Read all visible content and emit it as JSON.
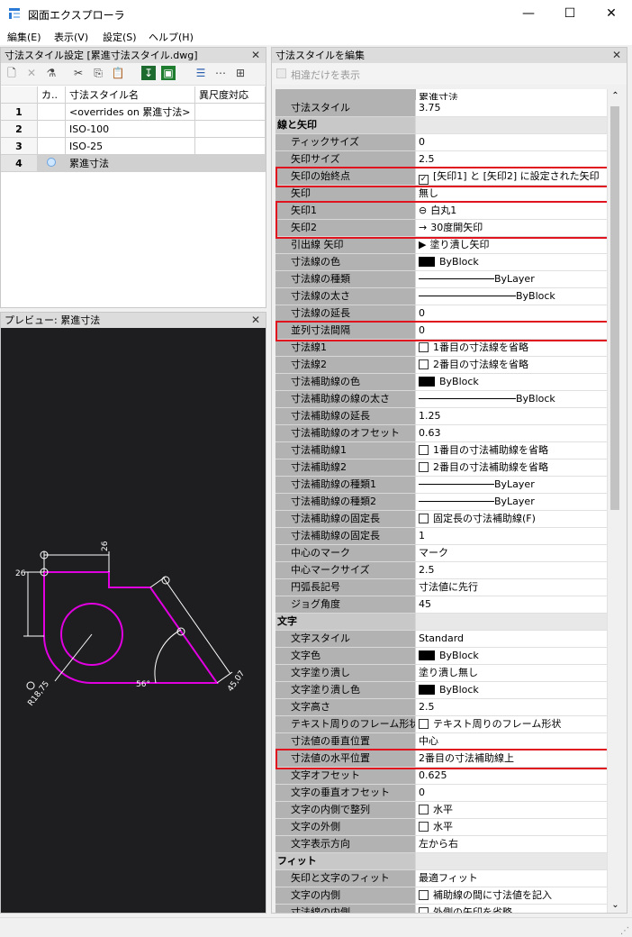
{
  "window": {
    "title": "図面エクスプローラ",
    "minimize": "—",
    "maximize": "☐",
    "close": "✕"
  },
  "menu": [
    "編集(E)",
    "表示(V)",
    "設定(S)",
    "ヘルプ(H)"
  ],
  "left_panel": {
    "header": "寸法スタイル設定 [累進寸法スタイル.dwg]",
    "columns": [
      "カ..",
      "寸法スタイル名",
      "異尺度対応"
    ],
    "rows": [
      {
        "num": "1",
        "name": "<overrides on 累進寸法>"
      },
      {
        "num": "2",
        "name": "ISO-100"
      },
      {
        "num": "3",
        "name": "ISO-25"
      },
      {
        "num": "4",
        "name": "累進寸法"
      }
    ],
    "selected_row": 4
  },
  "preview": {
    "header": "プレビュー: 累進寸法",
    "labels": {
      "d26_top": "26",
      "d26_left": "26",
      "d45": "45,07",
      "radius": "R18,75",
      "angle": "56°"
    },
    "colors": {
      "shape": "#e000e0",
      "dim": "#ffffff",
      "bg": "#1e1e20"
    }
  },
  "right_panel": {
    "header": "寸法スタイルを編集",
    "diff_only_label": "相違だけを表示",
    "column_title": "累進寸法",
    "rows": [
      {
        "name": "寸法スタイル",
        "value": "3.75",
        "type": "partial"
      },
      {
        "name": "線と矢印",
        "type": "category"
      },
      {
        "name": "ティックサイズ",
        "value": "0"
      },
      {
        "name": "矢印サイズ",
        "value": "2.5"
      },
      {
        "name": "矢印の始終点",
        "value": "[矢印1] と [矢印2] に設定された矢印",
        "check": "✓",
        "highlight": true
      },
      {
        "name": "矢印",
        "value": "無し",
        "indent": true
      },
      {
        "name": "矢印1",
        "value": "白丸1",
        "glyph": "⊖",
        "highlight": true
      },
      {
        "name": "矢印2",
        "value": "30度開矢印",
        "glyph": "→",
        "highlight": true
      },
      {
        "name": "引出線 矢印",
        "value": "塗り潰し矢印",
        "glyph": "▶"
      },
      {
        "name": "寸法線の色",
        "value": "ByBlock",
        "swatch": true
      },
      {
        "name": "寸法線の種類",
        "value": "ByLayer",
        "line": true
      },
      {
        "name": "寸法線の太さ",
        "value": "ByBlock",
        "line": true,
        "long": true
      },
      {
        "name": "寸法線の延長",
        "value": "0"
      },
      {
        "name": "並列寸法間隔",
        "value": "0",
        "highlight": true
      },
      {
        "name": "寸法線1",
        "value": "1番目の寸法線を省略",
        "check": ""
      },
      {
        "name": "寸法線2",
        "value": "2番目の寸法線を省略",
        "check": ""
      },
      {
        "name": "寸法補助線の色",
        "value": "ByBlock",
        "swatch": true
      },
      {
        "name": "寸法補助線の線の太さ",
        "value": "ByBlock",
        "line": true,
        "long": true
      },
      {
        "name": "寸法補助線の延長",
        "value": "1.25"
      },
      {
        "name": "寸法補助線のオフセット",
        "value": "0.63"
      },
      {
        "name": "寸法補助線1",
        "value": "1番目の寸法補助線を省略",
        "check": ""
      },
      {
        "name": "寸法補助線2",
        "value": "2番目の寸法補助線を省略",
        "check": ""
      },
      {
        "name": "寸法補助線の種類1",
        "value": "ByLayer",
        "line": true
      },
      {
        "name": "寸法補助線の種類2",
        "value": "ByLayer",
        "line": true
      },
      {
        "name": "寸法補助線の固定長",
        "value": "固定長の寸法補助線(F)",
        "check": ""
      },
      {
        "name": "寸法補助線の固定長",
        "value": "1"
      },
      {
        "name": "中心のマーク",
        "value": "マーク"
      },
      {
        "name": "中心マークサイズ",
        "value": "2.5"
      },
      {
        "name": "円弧長記号",
        "value": "寸法値に先行"
      },
      {
        "name": "ジョグ角度",
        "value": "45"
      },
      {
        "name": "文字",
        "type": "category"
      },
      {
        "name": "文字スタイル",
        "value": "Standard"
      },
      {
        "name": "文字色",
        "value": "ByBlock",
        "swatch": true
      },
      {
        "name": "文字塗り潰し",
        "value": "塗り潰し無し"
      },
      {
        "name": "文字塗り潰し色",
        "value": "ByBlock",
        "swatch": true
      },
      {
        "name": "文字高さ",
        "value": "2.5"
      },
      {
        "name": "テキスト周りのフレーム形状",
        "value": "テキスト周りのフレーム形状",
        "check": ""
      },
      {
        "name": "寸法値の垂直位置",
        "value": "中心"
      },
      {
        "name": "寸法値の水平位置",
        "value": "2番目の寸法補助線上",
        "highlight": true
      },
      {
        "name": "文字オフセット",
        "value": "0.625"
      },
      {
        "name": "文字の垂直オフセット",
        "value": "0"
      },
      {
        "name": "文字の内側で整列",
        "value": "水平",
        "check": ""
      },
      {
        "name": "文字の外側",
        "value": "水平",
        "check": ""
      },
      {
        "name": "文字表示方向",
        "value": "左から右"
      },
      {
        "name": "フィット",
        "type": "category"
      },
      {
        "name": "矢印と文字のフィット",
        "value": "最適フィット"
      },
      {
        "name": "文字の内側",
        "value": "補助線の間に寸法値を記入",
        "check": ""
      },
      {
        "name": "寸法線の内側",
        "value": "外側の矢印を省略",
        "check": "",
        "type": "partial"
      }
    ]
  }
}
